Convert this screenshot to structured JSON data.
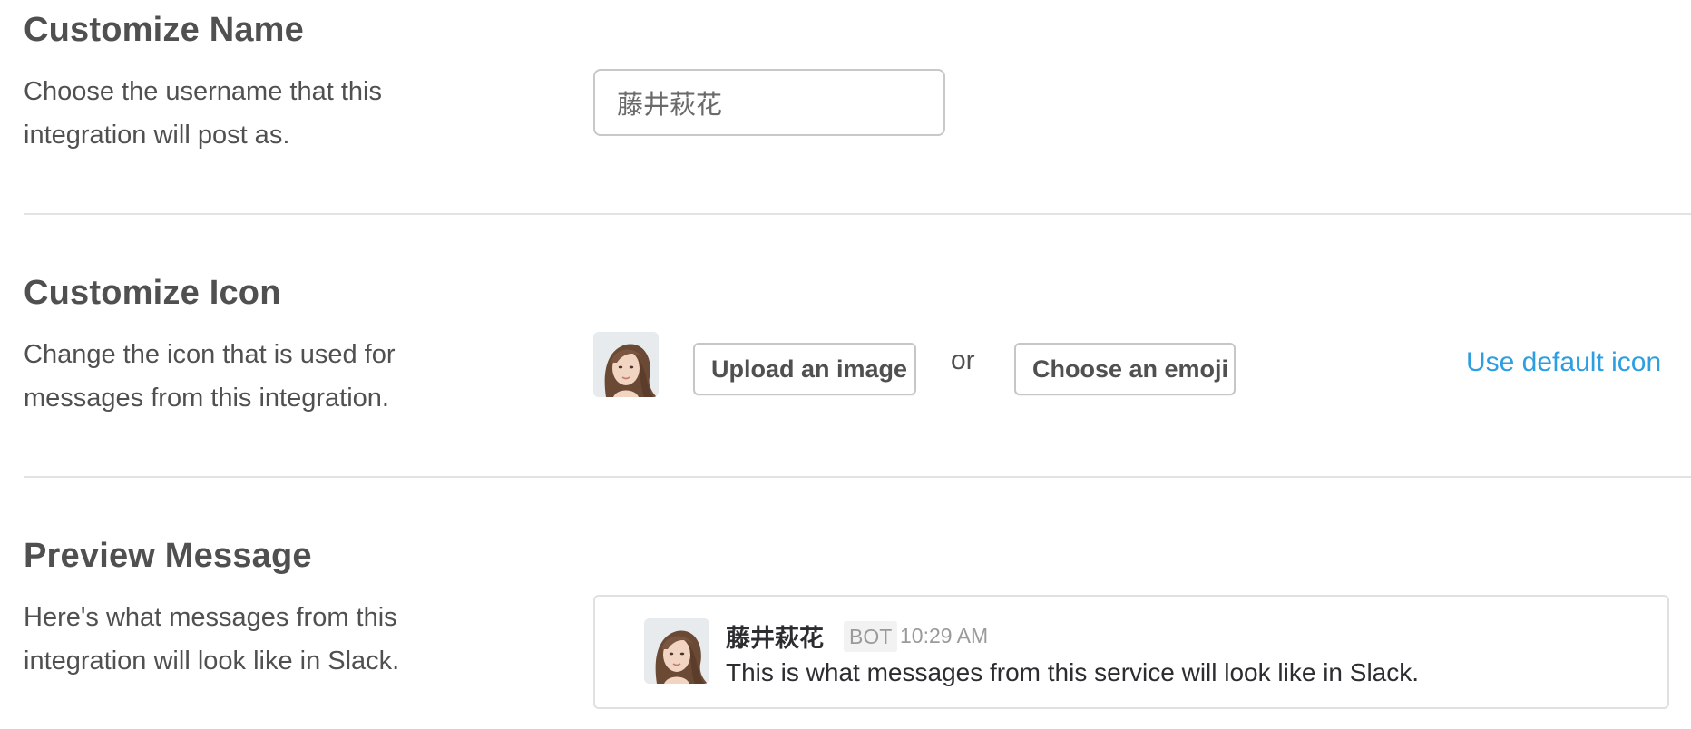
{
  "customize_name": {
    "title": "Customize Name",
    "description": "Choose the username that this integration will post as.",
    "input_value": "藤井萩花"
  },
  "customize_icon": {
    "title": "Customize Icon",
    "description": "Change the icon that is used for messages from this integration.",
    "upload_label": "Upload an image",
    "or_label": "or",
    "emoji_label": "Choose an emoji",
    "default_link": "Use default icon"
  },
  "preview_message": {
    "title": "Preview Message",
    "description": "Here's what messages from this integration will look like in Slack.",
    "message": {
      "username": "藤井萩花",
      "badge": "BOT",
      "time": "10:29 AM",
      "text": "This is what messages from this service will look like in Slack."
    }
  },
  "colors": {
    "link": "#2d9ee0",
    "text": "#505050",
    "divider": "#e3e3e3"
  },
  "icons": {
    "avatar": "user-photo-avatar"
  }
}
